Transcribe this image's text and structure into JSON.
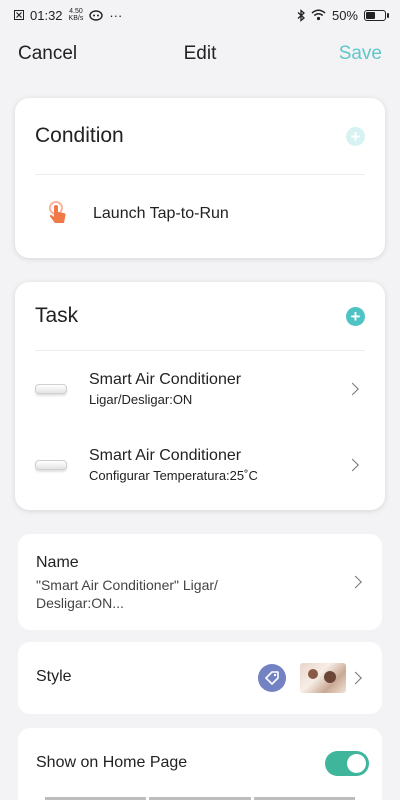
{
  "status_bar": {
    "time": "01:32",
    "net_speed_value": "4.50",
    "net_speed_unit": "KB/s",
    "more": "···",
    "battery_percent": "50%",
    "battery_level": 0.5
  },
  "nav": {
    "cancel_label": "Cancel",
    "title": "Edit",
    "save_label": "Save"
  },
  "condition": {
    "heading": "Condition",
    "add_icon": "plus-icon",
    "item_label": "Launch Tap-to-Run",
    "item_icon": "tap-hand-icon"
  },
  "task": {
    "heading": "Task",
    "add_icon": "plus-icon",
    "items": [
      {
        "title": "Smart Air Conditioner",
        "subtitle": "Ligar/Desligar:ON",
        "icon": "air-conditioner-icon"
      },
      {
        "title": "Smart Air Conditioner",
        "subtitle": "Configurar Temperatura:25˚C",
        "icon": "air-conditioner-icon"
      }
    ]
  },
  "name_row": {
    "label": "Name",
    "value_line1": " \"Smart Air Conditioner\" Ligar/",
    "value_line2": "Desligar:ON..."
  },
  "style_row": {
    "label": "Style",
    "tag_icon": "tag-icon",
    "thumbnail": "photo-thumbnail"
  },
  "home_row": {
    "label": "Show on Home Page",
    "toggle_on": true
  },
  "colors": {
    "accent": "#4ec3c4",
    "save": "#5ec7c9",
    "toggle": "#3fb69b",
    "condition_icon": "#f07a47",
    "style_tag": "#7282c3"
  }
}
